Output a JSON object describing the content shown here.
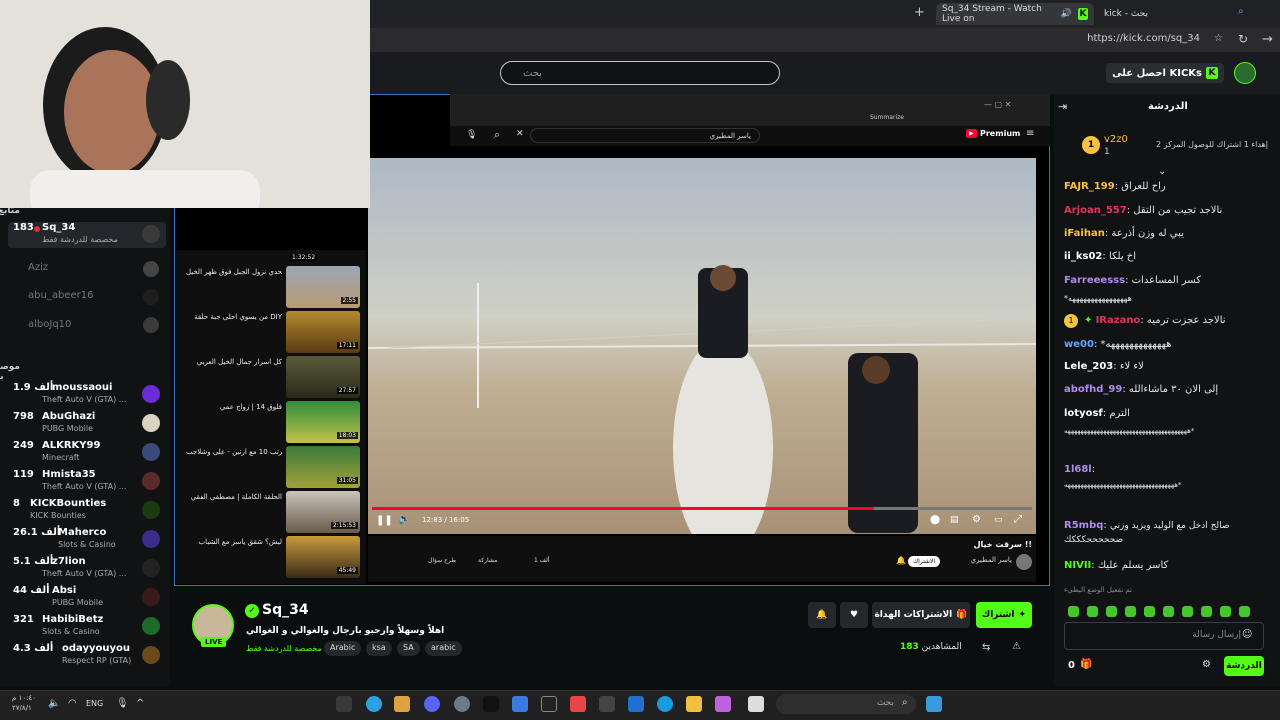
{
  "browser": {
    "tabs": [
      {
        "label": "Sq_34 Stream - Watch Live on"
      },
      {
        "label": "kick - بحث"
      }
    ],
    "url": "https://kick.com/sq_34"
  },
  "header": {
    "search_placeholder": "بحث",
    "get_kicks_label": "احصل على KICKs"
  },
  "sidebar": {
    "following_header": "متابع",
    "following": [
      {
        "name": "Sq_34",
        "count": "183",
        "category": "مخصصة للدردشة فقط",
        "live": true
      },
      {
        "name": "Aziz",
        "live": false
      },
      {
        "name": "abu_abeer16",
        "live": false
      },
      {
        "name": "alboJq10",
        "live": false
      }
    ],
    "recommended_header": "موصى بها",
    "recommended": [
      {
        "name": "moussaoui",
        "count": "1.9 ألف",
        "category": "Theft Auto V (GTA) ..."
      },
      {
        "name": "AbuGhazi",
        "count": "798",
        "category": "PUBG Mobile"
      },
      {
        "name": "ALKRKY99",
        "count": "249",
        "category": "Minecraft"
      },
      {
        "name": "Hmista35",
        "count": "119",
        "category": "Theft Auto V (GTA) ..."
      },
      {
        "name": "KICKBounties",
        "count": "8",
        "category": "KICK Bounties"
      },
      {
        "name": "Maherco",
        "count": "26.1 ألف",
        "category": "Slots & Casino"
      },
      {
        "name": "z7lion",
        "count": "5.1 ألف",
        "category": "Theft Auto V (GTA) ..."
      },
      {
        "name": "Absi",
        "count": "44 ألف",
        "category": "PUBG Mobile"
      },
      {
        "name": "HabibiBetz",
        "count": "321",
        "category": "Slots & Casino"
      },
      {
        "name": "odayyouyou",
        "count": "4.3 ألف",
        "category": "Respect RP (GTA)"
      }
    ]
  },
  "youtube": {
    "channel_search": "ياسر المطيري",
    "premium_label": "Premium",
    "summarize_label": "Summarize",
    "time": "12:83 / 16:05",
    "progress": 0.76,
    "video_title": "سرقت خيال !!",
    "video_channel": "ياسر المطيري",
    "subscribe": "الاشتراك",
    "likes": "1 ألف",
    "share": "مشاركة",
    "ask": "طرح سؤال",
    "related": [
      {
        "title": "تحدي نزول الجبل فوق ظهر الخيل",
        "duration": "2:55"
      },
      {
        "title": "من يسوي احلى جبة حلقة DIY",
        "duration": "17:11"
      },
      {
        "title": "كل اسرار جمال الخيل العربي",
        "duration": "27:57"
      },
      {
        "title": "فلوق 14 | زواج عمي",
        "duration": "18:03"
      },
      {
        "title": "نرتب 10 مع ارتين - على وشلاجب",
        "duration": "31:05"
      },
      {
        "title": "الحلقة الكاملة | مصطفى الفقي",
        "duration": "2:15:53"
      },
      {
        "title": "ليش؟ شقق ياسر مع الشباب",
        "duration": "45:49"
      }
    ],
    "top_related_duration": "1:32:52"
  },
  "channel": {
    "name": "Sq_34",
    "live_badge": "LIVE",
    "title": "اهلاً وسهلاً وارحبو بارجال والغوالي و الغوالي",
    "category": "مخصصة للدردشة فقط",
    "tags": [
      "Arabic",
      "ksa",
      "SA",
      "arabic"
    ],
    "subscribe_label": "اشتراك",
    "gift_label": "الاشتراكات الهداة",
    "viewers_label": "المشاهدين",
    "viewers_count": "183"
  },
  "chat": {
    "title": "الدردشة",
    "gifter": {
      "rank": "1",
      "name": "v2z0",
      "count": "1",
      "note": "إهداء 1 اشتراك للوصول المركز 2"
    },
    "messages": [
      {
        "user": "FAJR_199",
        "color": "#f5c242",
        "text": "راح للعراق"
      },
      {
        "user": "Arjoan_557",
        "color": "#e0365a",
        "text": "نالاجد تجيب من التقل"
      },
      {
        "user": "iFaihan",
        "color": "#f5c242",
        "text": "يبي له وزن أذرعة"
      },
      {
        "user": "ii_ks02",
        "color": "#ffffff",
        "text": "اخ يلكا"
      },
      {
        "user": "Farreeesss",
        "color": "#b18cf0",
        "text": "كسر المساعدات"
      },
      {
        "user": "",
        "color": "#ffffff",
        "text": "*ههههههههههههههههه"
      },
      {
        "user": "IRazano",
        "color": "#e0365a",
        "text": "نالاجد عجزت ترميه"
      },
      {
        "user": "we00",
        "color": "#5fa8ff",
        "text": "*هههههههههههههه"
      },
      {
        "user": "Lele_203",
        "color": "#ffffff",
        "text": "لاء لاء"
      },
      {
        "user": "abofhd_99",
        "color": "#b18cf0",
        "text": "إلى الان ٣٠ ماشاءالله"
      },
      {
        "user": "lotyosf",
        "color": "#ffffff",
        "text": "الترم"
      },
      {
        "user": "",
        "color": "#ffffff",
        "text": "ههههههههههههههههههههههههههههههههههههههه*"
      },
      {
        "user": "1l68l",
        "color": "#b18cf0",
        "text": "ههههههههههههههههههههههههههههههههههه*"
      },
      {
        "user": "R5mbq",
        "color": "#b18cf0",
        "text": "صالح ادخل مع الوليد ويزيد وزني ضحححححكككك"
      },
      {
        "user": "NIVII",
        "color": "#53fc18",
        "text": "كاسر يسلم عليك"
      }
    ],
    "slow_mode_note": "تم تفعيل الوضع البطيء",
    "input_placeholder": "إرسال رسالة",
    "send_label": "الدردشة",
    "kicks_count": "0"
  },
  "taskbar": {
    "search_placeholder": "بحث",
    "lang": "ENG",
    "time": "١٠:٤٠ م",
    "date": "٢٧/٨/١"
  },
  "colors": {
    "kick_green": "#53fc18",
    "yt_red": "#ff0033",
    "bg": "#0b0e0f",
    "panel": "#101214"
  }
}
